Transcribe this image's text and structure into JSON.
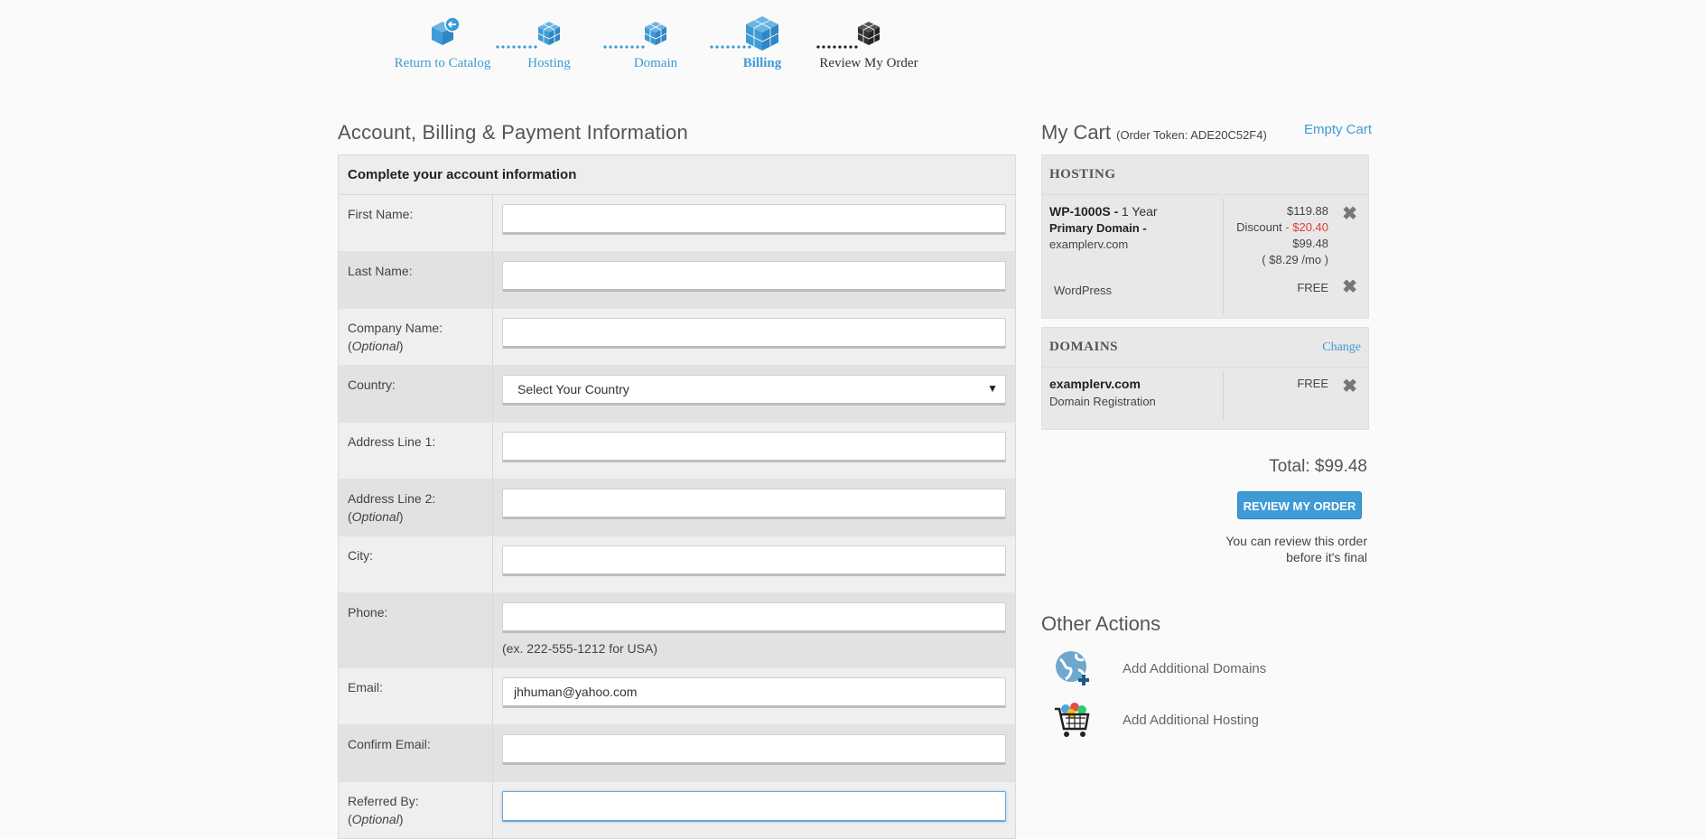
{
  "steps": [
    {
      "label": "Return to Catalog",
      "icon": "cube-return-icon",
      "state": "done"
    },
    {
      "label": "Hosting",
      "icon": "cube-icon",
      "state": "done"
    },
    {
      "label": "Domain",
      "icon": "cube-icon",
      "state": "done"
    },
    {
      "label": "Billing",
      "icon": "cube-icon",
      "state": "active"
    },
    {
      "label": "Review My Order",
      "icon": "cube-dark-icon",
      "state": "pending"
    }
  ],
  "form": {
    "section_title": "Account, Billing & Payment Information",
    "panel_title": "Complete your account information",
    "fields": [
      {
        "label": "First Name:",
        "value": "",
        "optional": ""
      },
      {
        "label": "Last Name:",
        "value": "",
        "optional": ""
      },
      {
        "label": "Company Name:",
        "value": "",
        "optional": "Optional"
      },
      {
        "label": "Country:",
        "value": "Select Your Country",
        "optional": ""
      },
      {
        "label": "Address Line 1:",
        "value": "",
        "optional": ""
      },
      {
        "label": "Address Line 2:",
        "value": "",
        "optional": "Optional"
      },
      {
        "label": "City:",
        "value": "",
        "optional": ""
      },
      {
        "label": "Phone:",
        "value": "",
        "optional": "",
        "hint": "(ex. 222-555-1212 for USA)"
      },
      {
        "label": "Email:",
        "value": "jhhuman@yahoo.com",
        "optional": ""
      },
      {
        "label": "Confirm Email:",
        "value": "",
        "optional": ""
      },
      {
        "label": "Referred By:",
        "value": "",
        "optional": "Optional"
      }
    ]
  },
  "cart": {
    "title": "My Cart",
    "token": "(Order Token: ADE20C52F4)",
    "empty_label": "Empty Cart",
    "hosting": {
      "heading": "HOSTING",
      "plan_name": "WP-1000S -",
      "plan_term": "1 Year",
      "primary_label": "Primary Domain -",
      "primary_domain": "examplerv.com",
      "price": "$119.88",
      "discount_label": "Discount",
      "discount_value": "- $20.40",
      "net": "$99.48",
      "monthly": "( $8.29 /mo )",
      "addon_name": "WordPress",
      "addon_price": "FREE"
    },
    "domains": {
      "heading": "DOMAINS",
      "change_label": "Change",
      "domain": "examplerv.com",
      "type": "Domain Registration",
      "price": "FREE"
    },
    "total": "Total: $99.48",
    "review_button": "REVIEW MY ORDER",
    "review_note_1": "You can review this order",
    "review_note_2": "before it's final"
  },
  "other_actions": {
    "title": "Other Actions",
    "items": [
      {
        "label": "Add Additional Domains",
        "icon": "globe-plus-icon"
      },
      {
        "label": "Add Additional Hosting",
        "icon": "shopping-cart-icon"
      }
    ]
  },
  "colors": {
    "accent": "#3e9bd6",
    "discount": "#e23c3c"
  }
}
